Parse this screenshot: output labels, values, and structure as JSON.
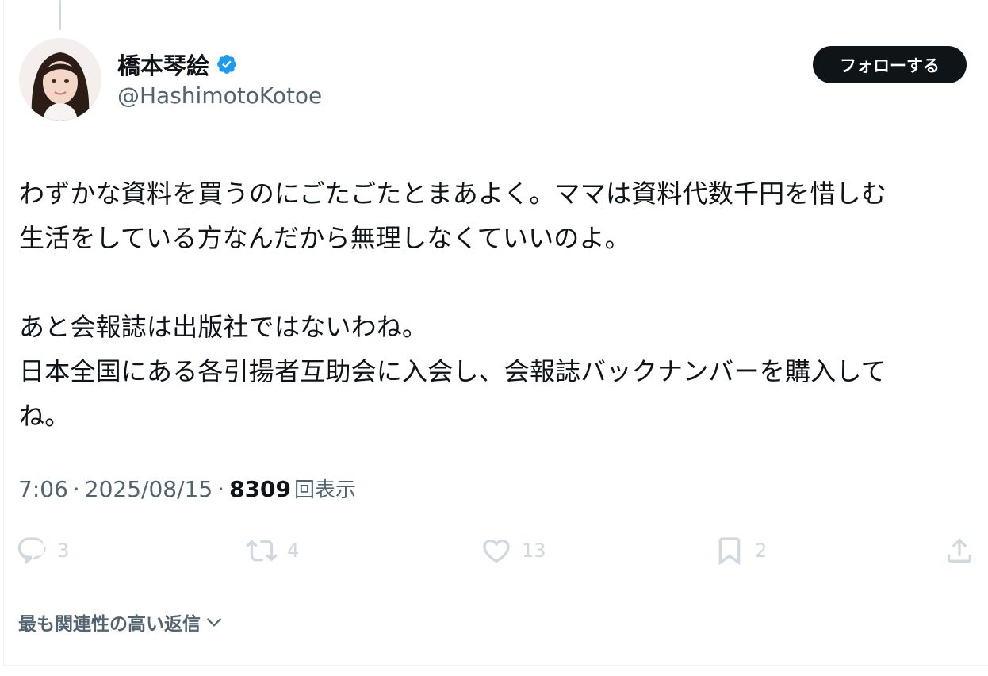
{
  "author": {
    "display_name": "橋本琴絵",
    "handle": "@HashimotoKotoe",
    "verified": true
  },
  "follow_button": {
    "label": "フォローする"
  },
  "tweet": {
    "text": "わずかな資料を買うのにごたごたとまあよく。ママは資料代数千円を惜しむ\n生活をしている方なんだから無理しなくていいのよ。\n\nあと会報誌は出版社ではないわね。\n日本全国にある各引揚者互助会に入会し、会報誌バックナンバーを購入して\nね。",
    "time": "7:06",
    "date": "2025/08/15",
    "views_count": "8309",
    "views_label": "回表示"
  },
  "actions": {
    "replies": "3",
    "reposts": "4",
    "likes": "13",
    "bookmarks": "2"
  },
  "replies_sort": {
    "label": "最も関連性の高い返信"
  },
  "colors": {
    "verified_blue": "#1d9bf0",
    "text_primary": "#0f1419",
    "text_secondary": "#536471",
    "action_icon": "#cfd9de"
  }
}
